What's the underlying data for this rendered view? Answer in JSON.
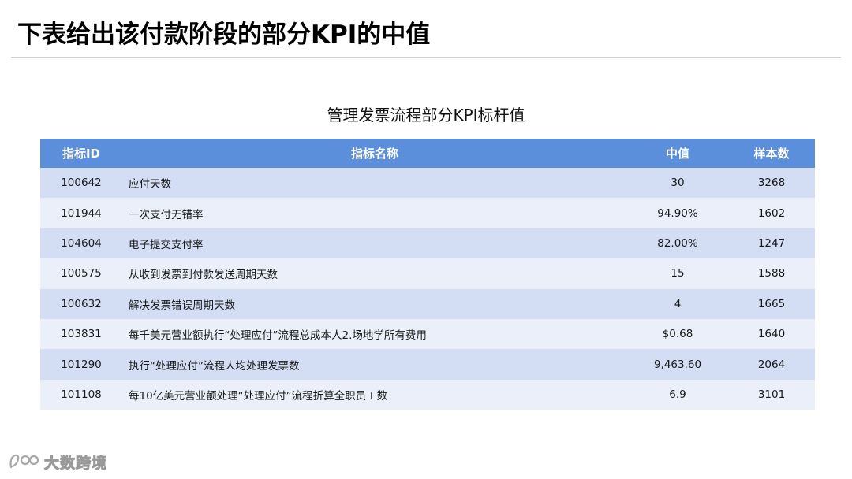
{
  "page": {
    "title": "下表给出该付款阶段的部分KPI的中值",
    "table_caption": "管理发票流程部分KPI标杆值"
  },
  "table": {
    "headers": {
      "id": "指标ID",
      "name": "指标名称",
      "median": "中值",
      "count": "样本数"
    },
    "rows": [
      {
        "id": "100642",
        "name": "应付天数",
        "median": "30",
        "count": "3268"
      },
      {
        "id": "101944",
        "name": "一次支付无错率",
        "median": "94.90%",
        "count": "1602"
      },
      {
        "id": "104604",
        "name": "电子提交支付率",
        "median": "82.00%",
        "count": "1247"
      },
      {
        "id": "100575",
        "name": "从收到发票到付款发送周期天数",
        "median": "15",
        "count": "1588"
      },
      {
        "id": "100632",
        "name": "解决发票错误周期天数",
        "median": "4",
        "count": "1665"
      },
      {
        "id": "103831",
        "name": "每千美元营业额执行“处理应付”流程总成本人2.场地学所有费用",
        "median": "$0.68",
        "count": "1640"
      },
      {
        "id": "101290",
        "name": "执行“处理应付”流程人均处理发票数",
        "median": "9,463.60",
        "count": "2064"
      },
      {
        "id": "101108",
        "name": "每10亿美元营业额处理“处理应付”流程折算全职员工数",
        "median": "6.9",
        "count": "3101"
      }
    ]
  },
  "watermark": {
    "text": "大数跨境",
    "icon": "brand-logo-icon"
  },
  "colors": {
    "header_bg": "#5b8fdc",
    "row_odd": "#d3def5",
    "row_even": "#eaeff9"
  }
}
